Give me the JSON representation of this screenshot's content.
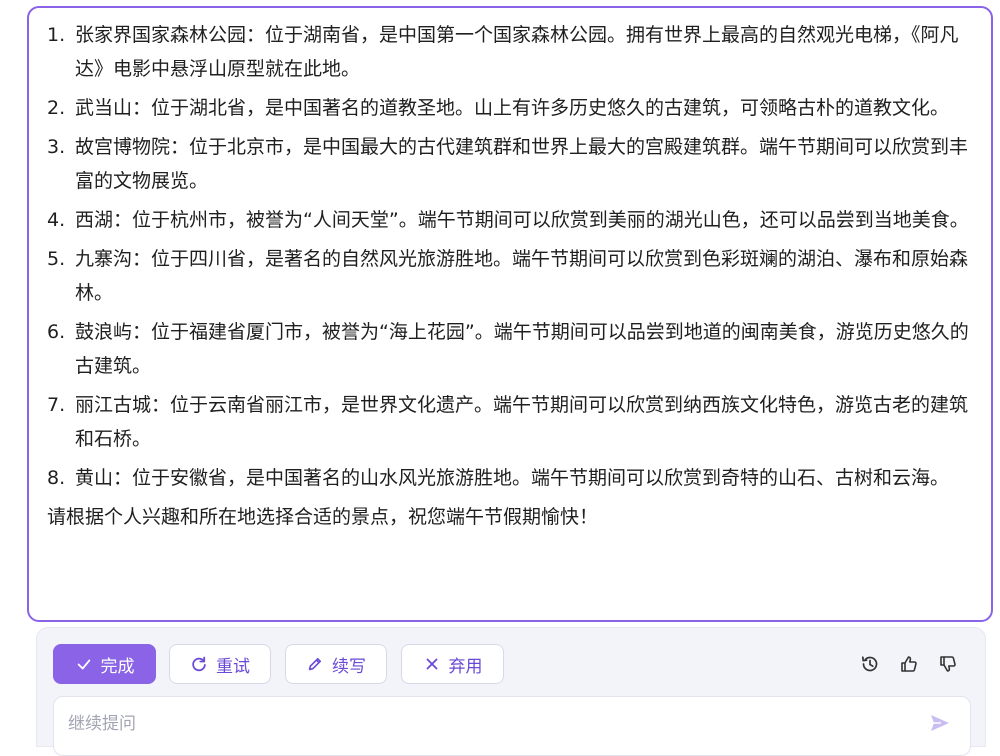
{
  "answer": {
    "items": [
      {
        "num": "1.",
        "text": "张家界国家森林公园：位于湖南省，是中国第一个国家森林公园。拥有世界上最高的自然观光电梯，《阿凡达》电影中悬浮山原型就在此地。"
      },
      {
        "num": "2.",
        "text": "武当山：位于湖北省，是中国著名的道教圣地。山上有许多历史悠久的古建筑，可领略古朴的道教文化。"
      },
      {
        "num": "3.",
        "text": "故宫博物院：位于北京市，是中国最大的古代建筑群和世界上最大的宫殿建筑群。端午节期间可以欣赏到丰富的文物展览。"
      },
      {
        "num": "4.",
        "text": "西湖：位于杭州市，被誉为“人间天堂”。端午节期间可以欣赏到美丽的湖光山色，还可以品尝到当地美食。"
      },
      {
        "num": "5.",
        "text": "九寨沟：位于四川省，是著名的自然风光旅游胜地。端午节期间可以欣赏到色彩斑斓的湖泊、瀑布和原始森林。"
      },
      {
        "num": "6.",
        "text": "鼓浪屿：位于福建省厦门市，被誉为“海上花园”。端午节期间可以品尝到地道的闽南美食，游览历史悠久的古建筑。"
      },
      {
        "num": "7.",
        "text": "丽江古城：位于云南省丽江市，是世界文化遗产。端午节期间可以欣赏到纳西族文化特色，游览古老的建筑和石桥。"
      },
      {
        "num": "8.",
        "text": "黄山：位于安徽省，是中国著名的山水风光旅游胜地。端午节期间可以欣赏到奇特的山石、古树和云海。"
      }
    ],
    "closing": "请根据个人兴趣和所在地选择合适的景点，祝您端午节假期愉快！"
  },
  "actions": {
    "done_label": "完成",
    "retry_label": "重试",
    "continue_label": "续写",
    "discard_label": "弃用"
  },
  "prompt": {
    "placeholder": "继续提问"
  },
  "colors": {
    "accent": "#8a63e6",
    "panel_bg": "#f3f4f9"
  }
}
